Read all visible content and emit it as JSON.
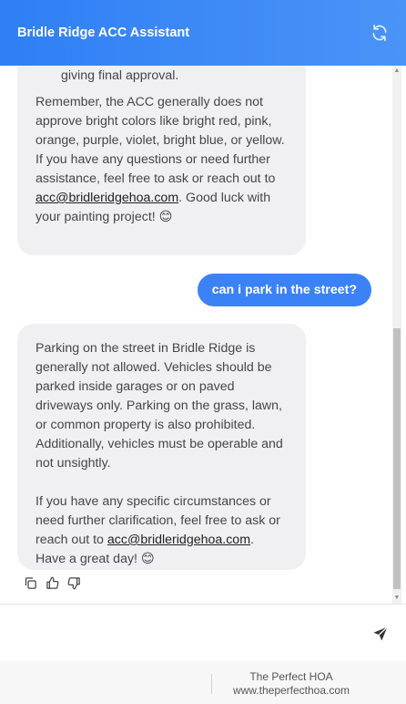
{
  "header": {
    "title": "Bridle Ridge ACC Assistant",
    "refresh_icon": "refresh-icon"
  },
  "messages": {
    "bot1": {
      "continued_text": "dried. They'll examine this before giving final approval.",
      "text_before_link": "Remember, the ACC generally does not approve bright colors like bright red, pink, orange, purple, violet, bright blue, or yellow. If you have any questions or need further assistance, feel free to ask or reach out to ",
      "link": "acc@bridleridgehoa.com",
      "text_after_link": ". Good luck with your painting project! 😊"
    },
    "user1": {
      "text": "can i park in the street?"
    },
    "bot2": {
      "p1": "Parking on the street in Bridle Ridge is generally not allowed. Vehicles should be parked inside garages or on paved driveways only. Parking on the grass, lawn, or common property is also prohibited. Additionally, vehicles must be operable and not unsightly.",
      "p2_before_link": "If you have any specific circumstances or need further clarification, feel free to ask or reach out to ",
      "link": "acc@bridleridgehoa.com",
      "p2_after_link": ". Have a great day! 😊"
    }
  },
  "input": {
    "placeholder": "",
    "value": ""
  },
  "footer": {
    "line1": "The Perfect HOA",
    "line2": "www.theperfecthoa.com"
  },
  "colors": {
    "accent": "#3b82f6",
    "bot_bubble": "#f0f0f2"
  }
}
